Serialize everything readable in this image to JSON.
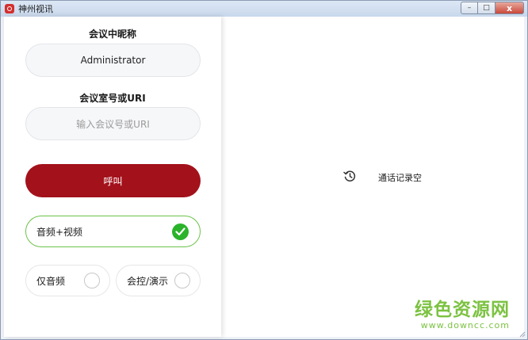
{
  "window": {
    "title": "神州视讯",
    "controls": {
      "minimize": "–",
      "maximize": "□",
      "close": "x"
    }
  },
  "form": {
    "nickname_label": "会议中昵称",
    "nickname_value": "Administrator",
    "room_label": "会议室号或URI",
    "room_placeholder": "输入会议号或URI",
    "call_label": "呼叫"
  },
  "options": {
    "av_label": "音频+视频",
    "av_selected": true,
    "audio_only_label": "仅音频",
    "audio_only_selected": false,
    "control_label": "会控/演示",
    "control_selected": false
  },
  "history": {
    "icon": "history-icon",
    "empty_text": "通话记录空"
  },
  "watermark": {
    "main": "绿色资源网",
    "sub": "www.downcc.com"
  },
  "colors": {
    "accent_red": "#a3111b",
    "check_green": "#2bb32b",
    "selected_border": "#6cc24a",
    "watermark_green": "#7cc242"
  }
}
